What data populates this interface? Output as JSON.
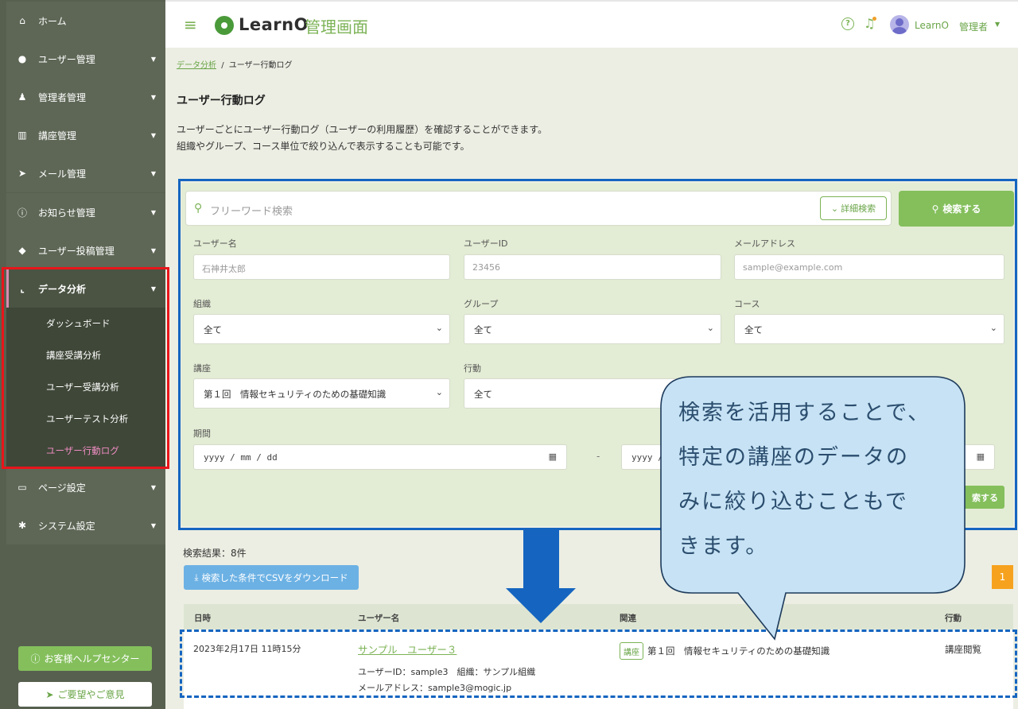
{
  "sidebar": {
    "items": [
      {
        "label": "ホーム",
        "icon": "home-icon"
      },
      {
        "label": "ユーザー管理",
        "icon": "user-icon"
      },
      {
        "label": "管理者管理",
        "icon": "admin-icon"
      },
      {
        "label": "講座管理",
        "icon": "book-icon"
      },
      {
        "label": "メール管理",
        "icon": "paper-plane-icon"
      },
      {
        "label": "お知らせ管理",
        "icon": "info-icon"
      },
      {
        "label": "ユーザー投稿管理",
        "icon": "comments-icon"
      },
      {
        "label": "データ分析",
        "icon": "chart-line-icon"
      },
      {
        "label": "ページ設定",
        "icon": "desktop-icon"
      },
      {
        "label": "システム設定",
        "icon": "gear-icon"
      }
    ],
    "sub_items": [
      {
        "label": "ダッシュボード"
      },
      {
        "label": "講座受講分析"
      },
      {
        "label": "ユーザー受講分析"
      },
      {
        "label": "ユーザーテスト分析"
      },
      {
        "label": "ユーザー行動ログ"
      }
    ],
    "help_label": "お客様ヘルプセンター",
    "feedback_label": "ご要望やご意見"
  },
  "header": {
    "logo_text": "LearnO",
    "logo_sub": "管理画面",
    "user_name": "LearnO",
    "user_role": "管理者"
  },
  "breadcrumb": {
    "parent": "データ分析",
    "separator": "/",
    "current": "ユーザー行動ログ"
  },
  "page": {
    "title": "ユーザー行動ログ",
    "desc_line1": "ユーザーごとにユーザー行動ログ（ユーザーの利用履歴）を確認することができます。",
    "desc_line2": "組織やグループ、コース単位で絞り込んで表示することも可能です。"
  },
  "search": {
    "freeword_placeholder": "フリーワード検索",
    "detail_label": "詳細検索",
    "search_label": "検索する",
    "username_label": "ユーザー名",
    "username_placeholder": "石神井太郎",
    "userid_label": "ユーザーID",
    "userid_placeholder": "23456",
    "email_label": "メールアドレス",
    "email_placeholder": "sample@example.com",
    "org_label": "組織",
    "org_value": "全て",
    "group_label": "グループ",
    "group_value": "全て",
    "course_label": "コース",
    "course_value": "全て",
    "lecture_label": "講座",
    "lecture_value": "第１回　情報セキュリティのための基礎知識",
    "action_label": "行動",
    "action_value": "全て",
    "period_label": "期間",
    "date_from_placeholder": "yyyy / mm / dd",
    "date_to_placeholder": "yyyy /",
    "period_separator": "-",
    "apply_label": "索する"
  },
  "results": {
    "count_text": "検索結果：8件",
    "csv_label": "検索した条件でCSVをダウンロード",
    "page_number": "1",
    "columns": [
      "日時",
      "ユーザー名",
      "関連",
      "行動"
    ],
    "rows": [
      {
        "datetime": "2023年2月17日 11時15分",
        "user_name": "サンプル　ユーザー３",
        "user_id_line": "ユーザーID：sample3　組織：サンプル組織",
        "email_line": "メールアドレス：sample3@mogic.jp",
        "badge": "講座",
        "related": "第１回　情報セキュリティのための基礎知識",
        "action": "講座閲覧"
      }
    ]
  },
  "callout": {
    "line1": "検索を活用することで、",
    "line2": "特定の講座のデータの",
    "line3": "みに絞り込むこともで",
    "line4": "きます。"
  },
  "colors": {
    "sidebar_bg": "#57604f",
    "accent_green": "#84bf5c",
    "highlight_blue": "#1565c0",
    "highlight_red": "#e8151b",
    "callout_fill": "#c6e2f4",
    "active_pink": "#f08dc4",
    "page_orange": "#f7a21e"
  }
}
